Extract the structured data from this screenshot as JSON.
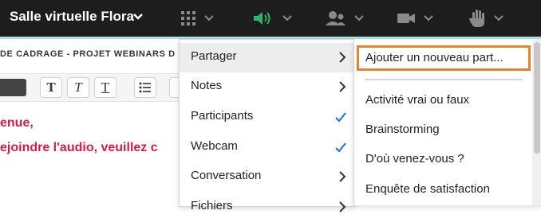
{
  "topbar": {
    "room_title": "Salle virtuelle Flora",
    "icons": [
      "grid-icon",
      "speaker-icon",
      "webcam-people-icon",
      "camera-icon",
      "raise-hand-icon"
    ],
    "speaker_color": "#2fb36b",
    "icon_color": "#8a8a8a"
  },
  "document": {
    "header": "DE CADRAGE - PROJET WEBINARS D",
    "line1": "enue,",
    "line2": "ejoindre l'audio, veuillez c",
    "text_color": "#d81b42"
  },
  "menu": {
    "items": [
      {
        "label": "Partager",
        "indicator": "chevron",
        "active": true
      },
      {
        "label": "Notes",
        "indicator": "chevron"
      },
      {
        "label": "Participants",
        "indicator": "check"
      },
      {
        "label": "Webcam",
        "indicator": "check"
      },
      {
        "label": "Conversation",
        "indicator": "chevron"
      },
      {
        "label": "Fichiers",
        "indicator": "chevron"
      }
    ],
    "check_color": "#1473e6"
  },
  "submenu": {
    "highlight_color": "#e8822e",
    "items": [
      {
        "label": "Ajouter un nouveau part..."
      },
      {
        "label": "Activité vrai ou faux"
      },
      {
        "label": "Brainstorming"
      },
      {
        "label": "D'où venez-vous ?"
      },
      {
        "label": "Enquête de satisfaction"
      }
    ]
  }
}
